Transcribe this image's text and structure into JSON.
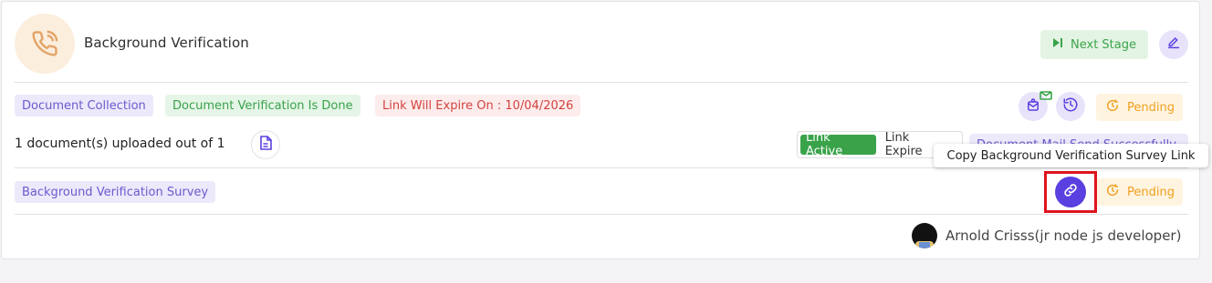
{
  "header": {
    "title": "Background Verification",
    "next_stage_label": "Next Stage"
  },
  "row1": {
    "tags": [
      "Document Collection",
      "Document Verification Is Done",
      "Link Will Expire On : 10/04/2026"
    ],
    "status": "Pending"
  },
  "row2": {
    "uploaded_text": "1 document(s) uploaded out of 1",
    "link_active_label": "Link Active",
    "link_expire_label": "Link Expire",
    "mail_sent_label": "Document Mail Send Successfully"
  },
  "tooltip": {
    "text": "Copy Background Verification Survey Link"
  },
  "row3": {
    "tag": "Background Verification Survey",
    "status": "Pending"
  },
  "footer": {
    "user": "Arnold Crisss(jr node js developer)"
  },
  "colors": {
    "accent_purple": "#5a40e0",
    "success_green": "#3aa34a",
    "pending_orange": "#f0a020",
    "danger_red": "#d2433e",
    "highlight_red": "#e0141d"
  },
  "icons": [
    "phone-icon",
    "skip-next-icon",
    "edit-icon",
    "mail-check-icon",
    "history-icon",
    "pending-clock-icon",
    "document-icon",
    "link-icon"
  ]
}
